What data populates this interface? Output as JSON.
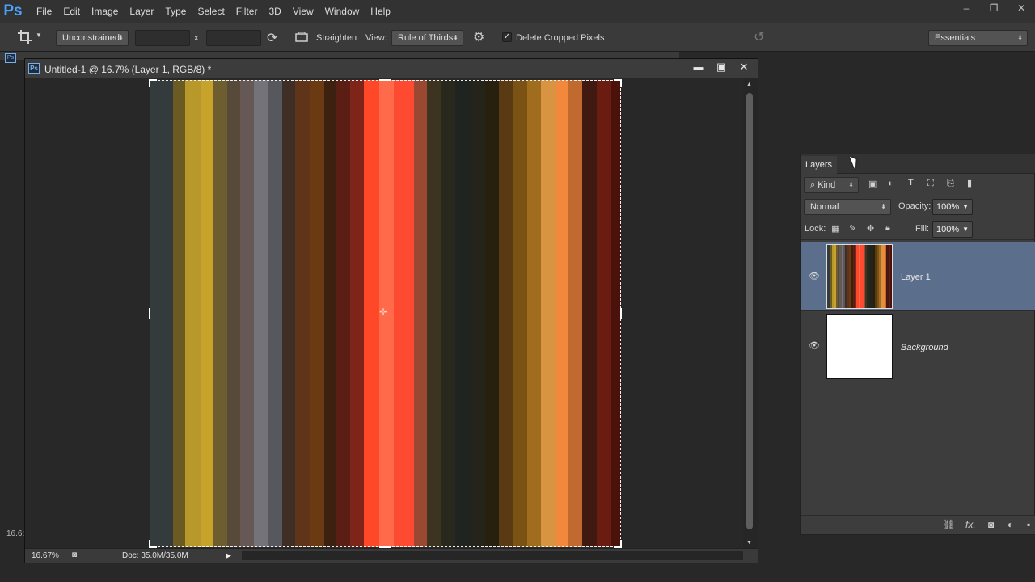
{
  "app": {
    "logo": "Ps"
  },
  "menu": [
    "File",
    "Edit",
    "Image",
    "Layer",
    "Type",
    "Select",
    "Filter",
    "3D",
    "View",
    "Window",
    "Help"
  ],
  "window_controls": {
    "minimize": "–",
    "restore": "❐",
    "close": "✕"
  },
  "options_bar": {
    "tool_icon": "crop-icon",
    "ratio": "Unconstrained",
    "width_value": "",
    "x_label": "x",
    "height_value": "",
    "straighten_label": "Straighten",
    "view_label": "View:",
    "view_value": "Rule of Thirds",
    "delete_cropped_label": "Delete Cropped Pixels",
    "delete_cropped_checked": true,
    "workspace": "Essentials"
  },
  "document": {
    "title": "Untitled-1 @ 16.7% (Layer 1, RGB/8) *",
    "zoom": "16.67%",
    "doc_info": "Doc: 35.0M/35.0M",
    "side_zoom": "16.6:",
    "stripe_colors": [
      "#333b3c",
      "#6b5a22",
      "#b8982a",
      "#c8a32c",
      "#6e5d2e",
      "#584a3a",
      "#665854",
      "#75737a",
      "#57585e",
      "#3e2e26",
      "#5f3418",
      "#6b3a12",
      "#3e2010",
      "#5b1e14",
      "#7e2418",
      "#ff4828",
      "#ff6a4a",
      "#ff4a32",
      "#9a4832",
      "#3c3420",
      "#28281c",
      "#1f2421",
      "#26231a",
      "#28200e",
      "#5a3a12",
      "#7a5214",
      "#a06c1e",
      "#d89440",
      "#f2883c",
      "#c06a30",
      "#401a10",
      "#6a1c10",
      "#4a120a"
    ],
    "stripe_widths": [
      26,
      14,
      17,
      14,
      16,
      14,
      16,
      16,
      15,
      15,
      17,
      15,
      14,
      15,
      16,
      17,
      16,
      23,
      14,
      16,
      16,
      17,
      16,
      16,
      15,
      16,
      16,
      16,
      14,
      16,
      16,
      16,
      11
    ]
  },
  "layers_panel": {
    "tab": "Layers",
    "filter_kind": "Kind",
    "blend_mode": "Normal",
    "opacity_label": "Opacity:",
    "opacity_value": "100%",
    "lock_label": "Lock:",
    "fill_label": "Fill:",
    "fill_value": "100%",
    "layers": [
      {
        "name": "Layer 1",
        "selected": true,
        "visible": true
      },
      {
        "name": "Background",
        "selected": false,
        "visible": true
      }
    ]
  }
}
